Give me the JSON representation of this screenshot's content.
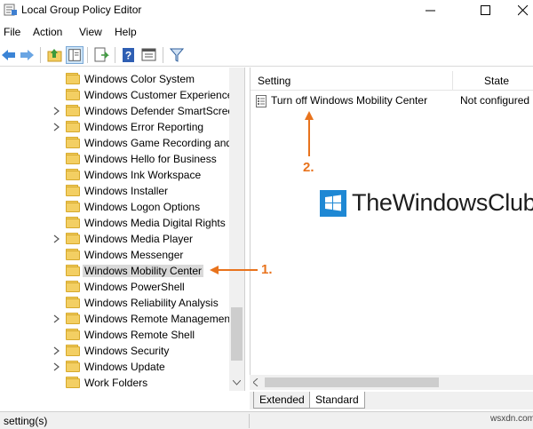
{
  "window": {
    "title": "Local Group Policy Editor"
  },
  "menu": [
    "File",
    "Action",
    "View",
    "Help"
  ],
  "toolbar": {
    "icons": [
      "back-arrow-icon",
      "forward-arrow-icon",
      "up-folder-icon",
      "show-hide-tree-icon",
      "export-list-icon",
      "help-icon",
      "properties-icon",
      "filter-icon"
    ]
  },
  "tree": {
    "items": [
      {
        "label": "Windows Color System",
        "expandable": false
      },
      {
        "label": "Windows Customer Experience",
        "expandable": false
      },
      {
        "label": "Windows Defender SmartScree",
        "expandable": true
      },
      {
        "label": "Windows Error Reporting",
        "expandable": true
      },
      {
        "label": "Windows Game Recording and",
        "expandable": false
      },
      {
        "label": "Windows Hello for Business",
        "expandable": false
      },
      {
        "label": "Windows Ink Workspace",
        "expandable": false
      },
      {
        "label": "Windows Installer",
        "expandable": false
      },
      {
        "label": "Windows Logon Options",
        "expandable": false
      },
      {
        "label": "Windows Media Digital Rights I",
        "expandable": false
      },
      {
        "label": "Windows Media Player",
        "expandable": true
      },
      {
        "label": "Windows Messenger",
        "expandable": false
      },
      {
        "label": "Windows Mobility Center",
        "expandable": false,
        "selected": true
      },
      {
        "label": "Windows PowerShell",
        "expandable": false
      },
      {
        "label": "Windows Reliability Analysis",
        "expandable": false
      },
      {
        "label": "Windows Remote Managemen",
        "expandable": true
      },
      {
        "label": "Windows Remote Shell",
        "expandable": false
      },
      {
        "label": "Windows Security",
        "expandable": true
      },
      {
        "label": "Windows Update",
        "expandable": true
      },
      {
        "label": "Work Folders",
        "expandable": false
      }
    ]
  },
  "list": {
    "columns": {
      "setting": "Setting",
      "state": "State"
    },
    "rows": [
      {
        "setting": "Turn off Windows Mobility Center",
        "state": "Not configured"
      }
    ]
  },
  "tabs": [
    "Extended",
    "Standard"
  ],
  "active_tab": "Standard",
  "status": {
    "text": "setting(s)"
  },
  "annotations": {
    "label_1": "1.",
    "label_2": "2.",
    "color": "#e8731d"
  },
  "overlay": {
    "brand": "TheWindowsClub",
    "watermark": "wsxdn.com"
  }
}
